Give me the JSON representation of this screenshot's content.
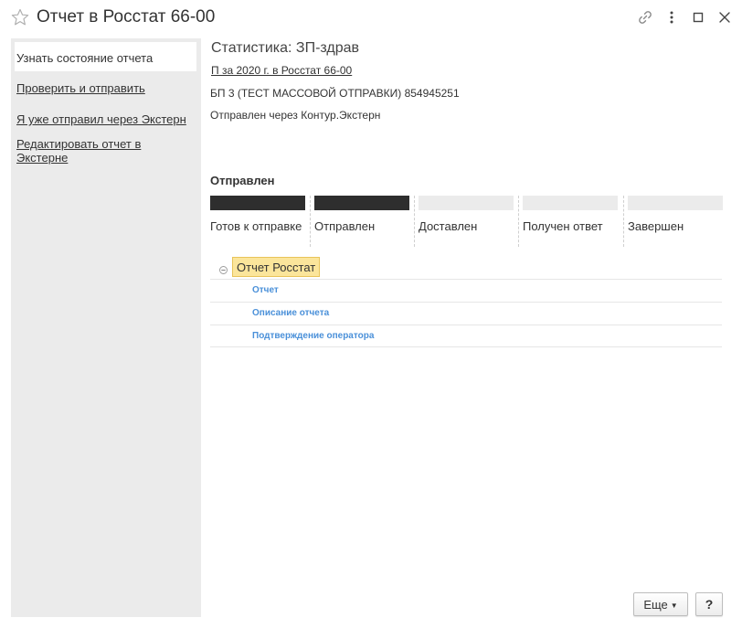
{
  "window": {
    "title": "Отчет в Росстат 66-00"
  },
  "sidebar": {
    "items": [
      {
        "label": "Узнать состояние отчета",
        "active": true
      },
      {
        "label": "Проверить и отправить"
      },
      {
        "label": "Я уже отправил через Экстерн"
      },
      {
        "label": "Редактировать отчет в Экстерне"
      }
    ]
  },
  "report": {
    "title": "Статистика: ЗП-здрав",
    "period_link": "П за 2020 г. в Росстат 66-00",
    "organization": "БП 3 (ТЕСТ МАССОВОЙ ОТПРАВКИ) 854945251",
    "sent_via": "Отправлен через Контур.Экстерн"
  },
  "status": {
    "heading": "Отправлен",
    "completed_stages": 2,
    "stages": [
      {
        "label": "Готов к отправке",
        "done": true
      },
      {
        "label": "Отправлен",
        "done": true
      },
      {
        "label": "Доставлен",
        "done": false
      },
      {
        "label": "Получен ответ",
        "done": false
      },
      {
        "label": "Завершен",
        "done": false
      }
    ]
  },
  "tree": {
    "root_label": "Отчет Росстат",
    "children": [
      {
        "label": "Отчет"
      },
      {
        "label": "Описание отчета"
      },
      {
        "label": "Подтверждение оператора"
      }
    ]
  },
  "buttons": {
    "more_label": "Еще",
    "help_label": "?"
  },
  "colors": {
    "stage_done": "#2e2e2e",
    "stage_pending": "#ebebeb",
    "tree_root_bg": "#fbe59b",
    "link_blue": "#4a90d9",
    "sidebar_bg": "#ebebeb"
  },
  "icons": {
    "favorite": "star-icon",
    "link": "link-icon",
    "more": "more-vertical-icon",
    "maximize": "maximize-icon",
    "close": "close-icon",
    "collapse": "collapse-icon"
  }
}
